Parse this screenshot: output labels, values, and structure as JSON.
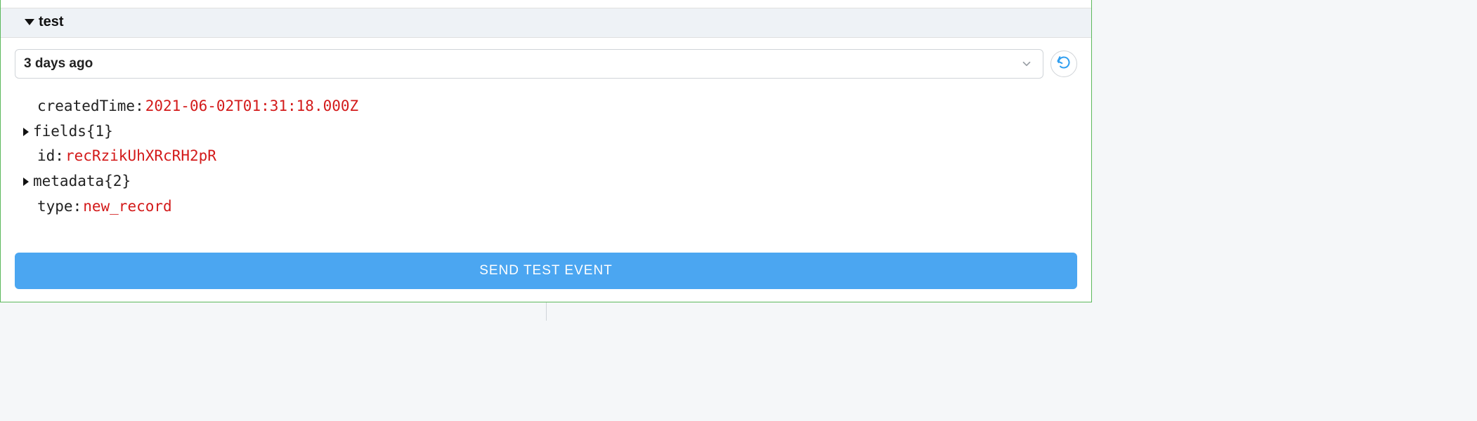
{
  "panel": {
    "title": "test"
  },
  "selector": {
    "selected_label": "3 days ago"
  },
  "event": {
    "rows": [
      {
        "key": "createdTime",
        "value": "2021-06-02T01:31:18.000Z",
        "type": "value"
      },
      {
        "key": "fields",
        "count": "{1}",
        "type": "object"
      },
      {
        "key": "id",
        "value": "recRzikUhXRcRH2pR",
        "type": "value"
      },
      {
        "key": "metadata",
        "count": "{2}",
        "type": "object"
      },
      {
        "key": "type",
        "value": "new_record",
        "type": "value"
      }
    ]
  },
  "actions": {
    "send_label": "SEND TEST EVENT"
  }
}
